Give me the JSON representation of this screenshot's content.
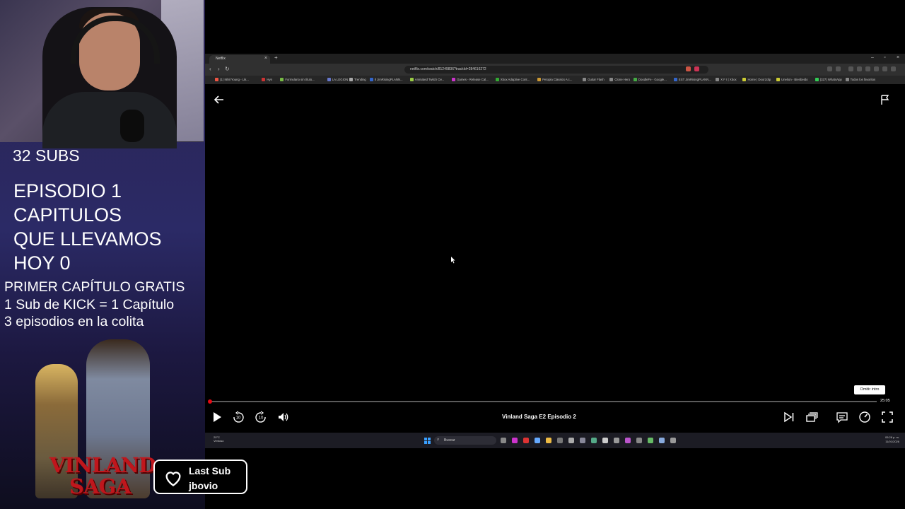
{
  "overlay": {
    "subs_count": "32 SUBS",
    "episode_lines": [
      "EPISODIO 1",
      "CAPITULOS",
      "QUE LLEVAMOS",
      "HOY 0"
    ],
    "info_lines": [
      "PRIMER CAPÍTULO GRATIS",
      "1 Sub de KICK = 1 Capítulo",
      "3 episodios en la colita"
    ],
    "logo_lines": [
      "VINLAND",
      "SAGA"
    ],
    "last_sub_label": "Last Sub",
    "last_sub_name": "jbovio"
  },
  "browser": {
    "tab_title": "Netflix",
    "tab_close": "×",
    "new_tab": "+",
    "window_controls": [
      "–",
      "▫",
      "×"
    ],
    "url": "netflix.com/watch/81249836?trackId=284616272",
    "bookmarks": [
      {
        "label": "(1) Nihil Young - Lik...",
        "color": "#e54"
      },
      {
        "label": "Hyn",
        "color": "#c33"
      },
      {
        "label": "Formulario sin título...",
        "color": "#7b4"
      },
      {
        "label": "LA LEGION",
        "color": "#67c"
      },
      {
        "label": "Trending",
        "color": "#aaa"
      },
      {
        "label": "Il JimRisingPLANN...",
        "color": "#36c"
      },
      {
        "label": "Animated Twitch Ov...",
        "color": "#9c4"
      },
      {
        "label": "Games - Release Cal...",
        "color": "#c3c"
      },
      {
        "label": "Xbox Adaptive Cont...",
        "color": "#3a3"
      },
      {
        "label": "Petopia Classics A c...",
        "color": "#c93"
      },
      {
        "label": "Guitar Flash",
        "color": "#888"
      },
      {
        "label": "Clone Hero",
        "color": "#888"
      },
      {
        "label": "DoodleFe - Google...",
        "color": "#4a4"
      },
      {
        "label": "EST JimRisingPLANN...",
        "color": "#36c"
      },
      {
        "label": "X F I | Xbox",
        "color": "#888"
      },
      {
        "label": "Home | Doorzclip",
        "color": "#cc3"
      },
      {
        "label": "Unelion - Bienbeido",
        "color": "#cc3"
      },
      {
        "label": "(327) WhatsApp",
        "color": "#3c5"
      },
      {
        "label": "Todos los favoritos",
        "color": "#888"
      }
    ]
  },
  "player": {
    "skip_intro": "Omitir intro",
    "time_remaining": "25:05",
    "episode_title": "Vinland Saga E2  Episodio 2",
    "progress_fraction": 0.003
  },
  "taskbar": {
    "weather_temp": "20°C",
    "weather_desc": "Ventoso",
    "search_label": "Buscar",
    "time": "05:28 p. m.",
    "date": "11/01/2026"
  }
}
